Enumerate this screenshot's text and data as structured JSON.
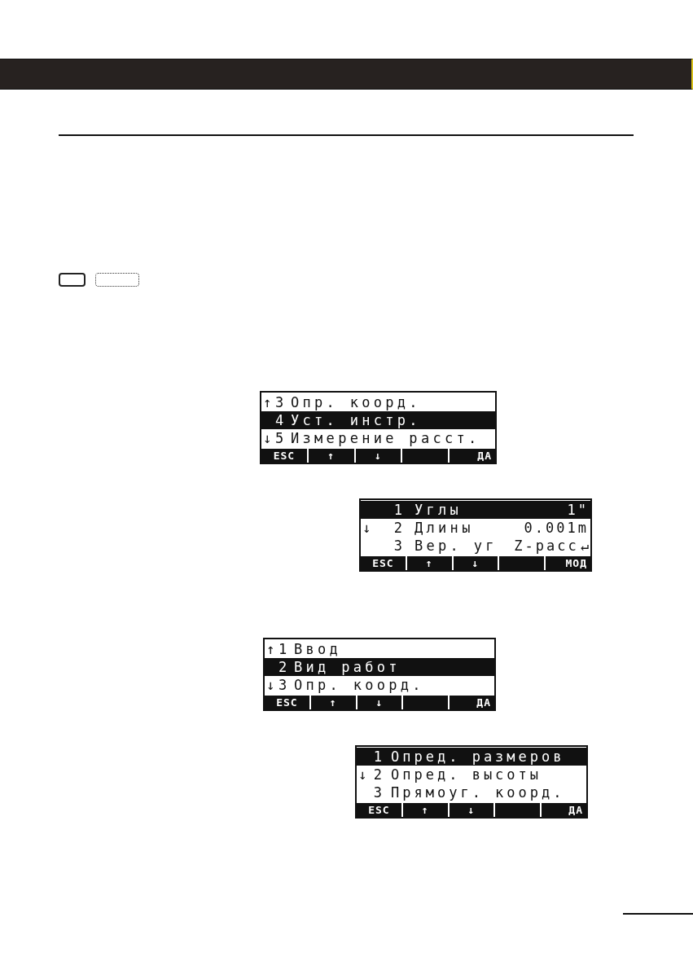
{
  "key_boxes": [
    {
      "kind": "solid"
    },
    {
      "kind": "dotted"
    }
  ],
  "screens": [
    {
      "rows": [
        {
          "arrow": "↑",
          "number": "3",
          "label": "Опр. коорд.",
          "selected": false
        },
        {
          "number": "4",
          "label": "Уст. инстр.",
          "selected": true
        },
        {
          "arrow": "↓",
          "number": "5",
          "label": "Измерение расст.",
          "selected": false
        }
      ],
      "softkeys": [
        {
          "kind": "key",
          "label": "ESC"
        },
        {
          "kind": "key",
          "label": "↑"
        },
        {
          "kind": "key",
          "label": "↓"
        },
        {
          "kind": "blank"
        },
        {
          "kind": "key",
          "label": "ДА"
        }
      ]
    },
    {
      "rows": [
        {
          "number": "1",
          "label": "Углы",
          "value": "1\"",
          "selected": true
        },
        {
          "arrow": "↓",
          "number": "2",
          "label": "Длины",
          "value": "0.001m",
          "selected": false
        },
        {
          "number": "3",
          "label": "Вер. уг",
          "value": "Z-расс",
          "enter_symbol": "↵",
          "selected": false
        }
      ],
      "softkeys": [
        {
          "kind": "key",
          "label": "ESC"
        },
        {
          "kind": "key",
          "label": "↑"
        },
        {
          "kind": "key",
          "label": "↓"
        },
        {
          "kind": "blank"
        },
        {
          "kind": "key",
          "label": "МОД"
        }
      ]
    },
    {
      "rows": [
        {
          "arrow": "↑",
          "number": "1",
          "label": "Ввод",
          "selected": false
        },
        {
          "number": "2",
          "label": "Вид работ",
          "selected": true
        },
        {
          "arrow": "↓",
          "number": "3",
          "label": "Опр. коорд.",
          "selected": false
        }
      ],
      "softkeys": [
        {
          "kind": "key",
          "label": "ESC"
        },
        {
          "kind": "key",
          "label": "↑"
        },
        {
          "kind": "key",
          "label": "↓"
        },
        {
          "kind": "blank"
        },
        {
          "kind": "key",
          "label": "ДА"
        }
      ]
    },
    {
      "rows": [
        {
          "number": "1",
          "label": "Опред. размеров",
          "selected": true
        },
        {
          "arrow": "↓",
          "number": "2",
          "label": "Опред. высоты",
          "selected": false
        },
        {
          "number": "3",
          "label": "Прямоуг. коорд.",
          "selected": false
        }
      ],
      "softkeys": [
        {
          "kind": "key",
          "label": "ESC"
        },
        {
          "kind": "key",
          "label": "↑"
        },
        {
          "kind": "key",
          "label": "↓"
        },
        {
          "kind": "blank"
        },
        {
          "kind": "key",
          "label": "ДА"
        }
      ]
    }
  ]
}
